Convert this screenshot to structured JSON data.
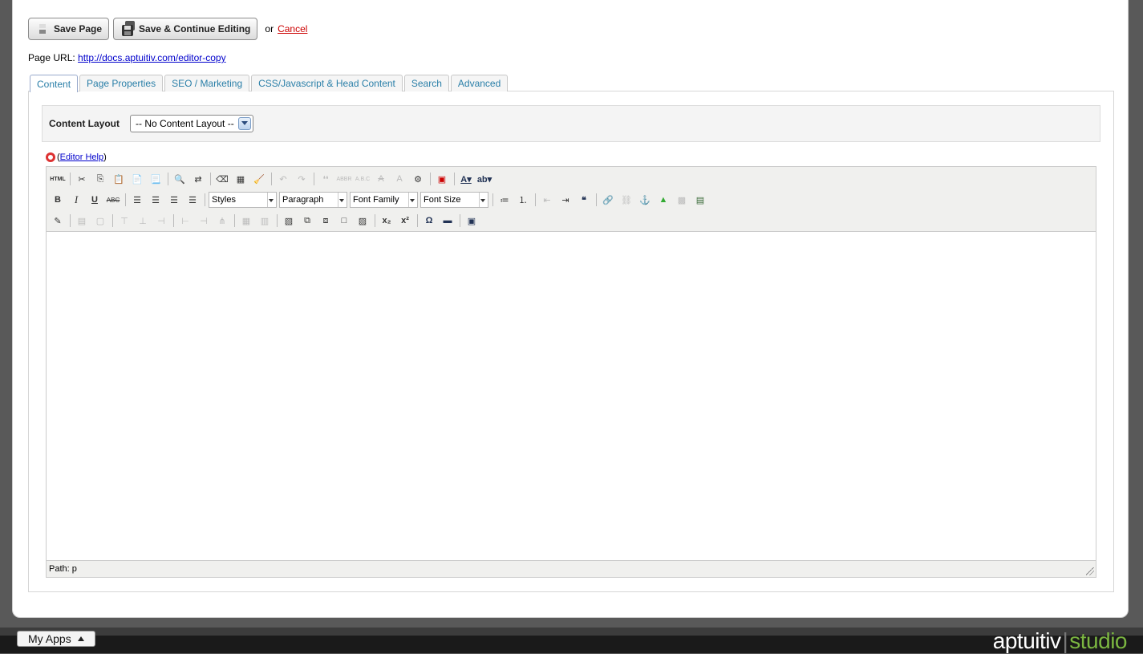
{
  "toolbar": {
    "save_label": "Save Page",
    "save_continue_label": "Save & Continue Editing",
    "or_text": "or",
    "cancel_label": "Cancel"
  },
  "page_url": {
    "label": "Page URL:",
    "link": "http://docs.aptuitiv.com/editor-copy"
  },
  "tabs": [
    {
      "label": "Content",
      "active": true
    },
    {
      "label": "Page Properties"
    },
    {
      "label": "SEO / Marketing"
    },
    {
      "label": "CSS/Javascript & Head Content"
    },
    {
      "label": "Search"
    },
    {
      "label": "Advanced"
    }
  ],
  "content_layout": {
    "label": "Content Layout",
    "selected": "-- No Content Layout --"
  },
  "editor": {
    "help_label": "Editor Help",
    "styles_select": "Styles",
    "format_select": "Paragraph",
    "font_family_select": "Font Family",
    "font_size_select": "Font Size",
    "path": "Path: p"
  },
  "footer": {
    "my_apps_label": "My Apps",
    "brand_main": "aptuitiv",
    "brand_sep": "|",
    "brand_sub": "studio"
  },
  "colors": {
    "tab_text": "#2a7fa8",
    "cancel": "#cc0000",
    "brand_green": "#7bb641"
  }
}
